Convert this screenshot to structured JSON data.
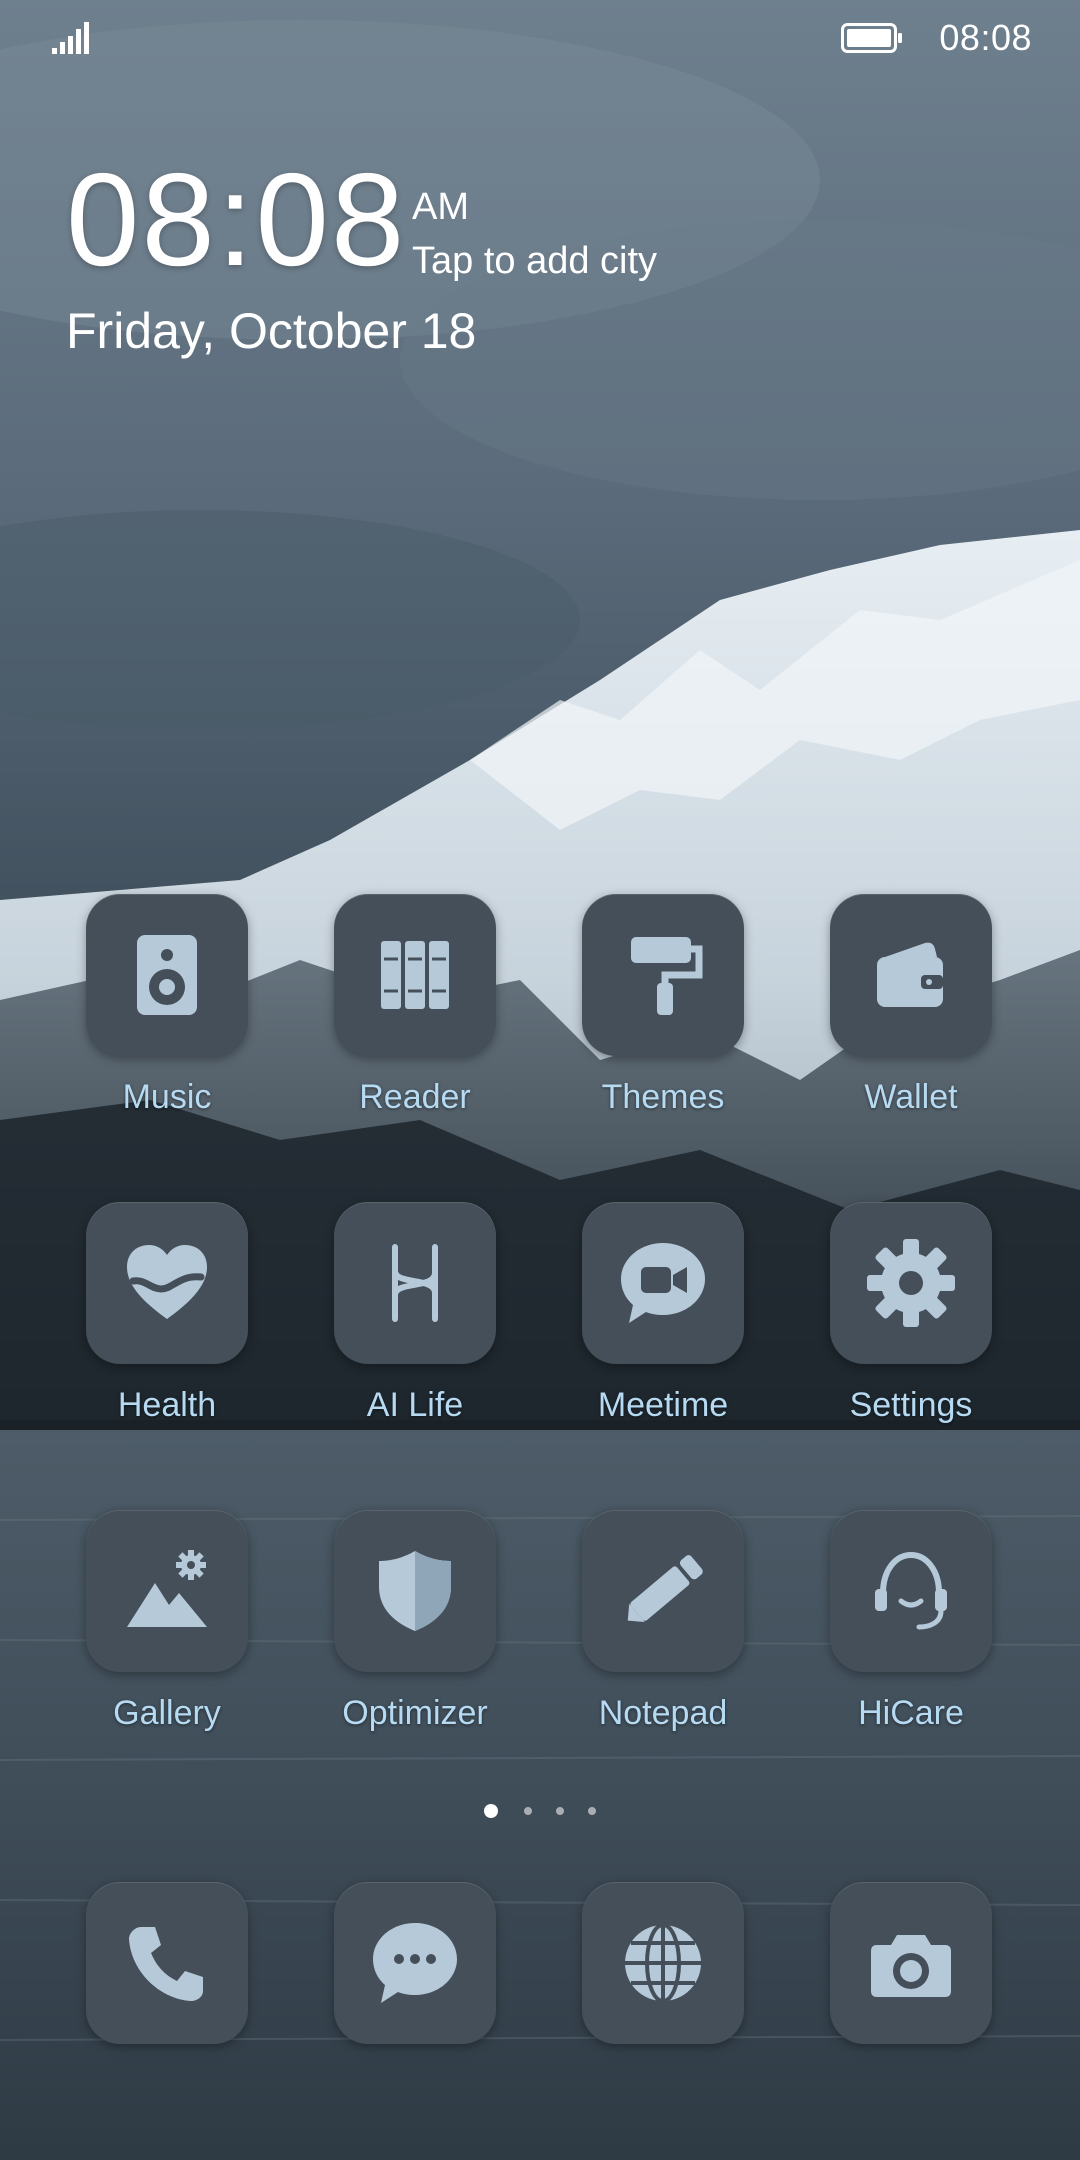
{
  "status_bar": {
    "time": "08:08"
  },
  "clock": {
    "time": "08:08",
    "ampm": "AM",
    "city_prompt": "Tap to add city",
    "date": "Friday, October 18"
  },
  "apps": [
    {
      "label": "Music",
      "icon": "speaker-icon"
    },
    {
      "label": "Reader",
      "icon": "books-icon"
    },
    {
      "label": "Themes",
      "icon": "paint-roller-icon"
    },
    {
      "label": "Wallet",
      "icon": "wallet-icon"
    },
    {
      "label": "Health",
      "icon": "heart-icon"
    },
    {
      "label": "AI Life",
      "icon": "ai-life-icon"
    },
    {
      "label": "Meetime",
      "icon": "video-chat-icon"
    },
    {
      "label": "Settings",
      "icon": "gear-icon"
    },
    {
      "label": "Gallery",
      "icon": "mountain-icon"
    },
    {
      "label": "Optimizer",
      "icon": "shield-icon"
    },
    {
      "label": "Notepad",
      "icon": "pencil-icon"
    },
    {
      "label": "HiCare",
      "icon": "headset-icon"
    }
  ],
  "dock": [
    {
      "icon": "phone-icon"
    },
    {
      "icon": "message-icon"
    },
    {
      "icon": "globe-icon"
    },
    {
      "icon": "camera-icon"
    }
  ],
  "page_indicator": {
    "pages": 4,
    "active": 1
  },
  "colors": {
    "tile": "#444f59",
    "icon": "#b5c9d9",
    "label": "#b7daf3"
  }
}
